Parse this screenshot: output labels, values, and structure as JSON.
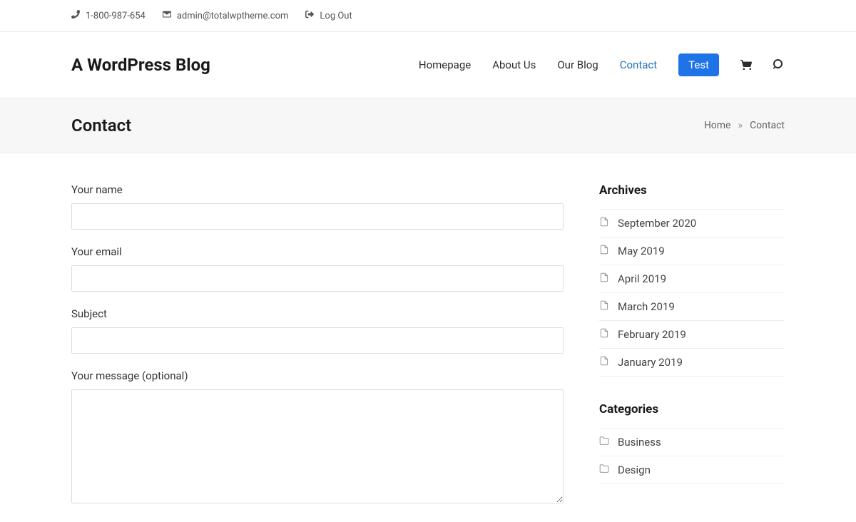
{
  "topbar": {
    "phone": "1-800-987-654",
    "email": "admin@totalwptheme.com",
    "logout_label": "Log Out"
  },
  "header": {
    "site_title": "A WordPress Blog",
    "nav": {
      "homepage": "Homepage",
      "about": "About Us",
      "blog": "Our Blog",
      "contact": "Contact",
      "test": "Test"
    }
  },
  "page": {
    "title": "Contact",
    "breadcrumb_home": "Home",
    "breadcrumb_sep": "»",
    "breadcrumb_current": "Contact"
  },
  "form": {
    "name_label": "Your name",
    "email_label": "Your email",
    "subject_label": "Subject",
    "message_label": "Your message (optional)"
  },
  "sidebar": {
    "archives_title": "Archives",
    "archives": [
      "September 2020",
      "May 2019",
      "April 2019",
      "March 2019",
      "February 2019",
      "January 2019"
    ],
    "categories_title": "Categories",
    "categories": [
      "Business",
      "Design"
    ]
  }
}
